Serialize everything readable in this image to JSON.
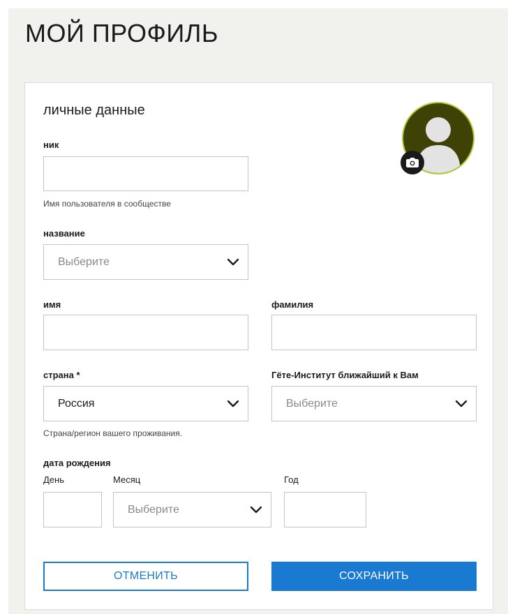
{
  "page": {
    "title": "МОЙ ПРОФИЛЬ"
  },
  "section": {
    "title": "личные данные"
  },
  "fields": {
    "nick": {
      "label": "ник",
      "value": "",
      "hint": "Имя пользователя в сообществе"
    },
    "salutation": {
      "label": "название",
      "selected": "Выберите"
    },
    "first_name": {
      "label": "имя",
      "value": ""
    },
    "last_name": {
      "label": "фамилия",
      "value": ""
    },
    "country": {
      "label": "страна *",
      "selected": "Россия",
      "hint": "Страна/регион вашего проживания."
    },
    "institute": {
      "label": "Гёте-Институт ближайший к Вам",
      "selected": "Выберите"
    },
    "birth_date": {
      "label": "дата рождения",
      "day_label": "День",
      "month_label": "Месяц",
      "year_label": "Год",
      "day_value": "",
      "month_selected": "Выберите",
      "year_value": ""
    }
  },
  "buttons": {
    "cancel": "ОТМЕНИТЬ",
    "save": "СОХРАНИТЬ"
  },
  "icons": {
    "avatar": "user-avatar-icon",
    "camera": "camera-icon",
    "dropdown": "chevron-down-icon"
  },
  "colors": {
    "accent": "#1a7ad1",
    "avatar_bg": "#3e4305",
    "avatar_ring": "#b4c934",
    "page_bg": "#f1f1ee"
  }
}
